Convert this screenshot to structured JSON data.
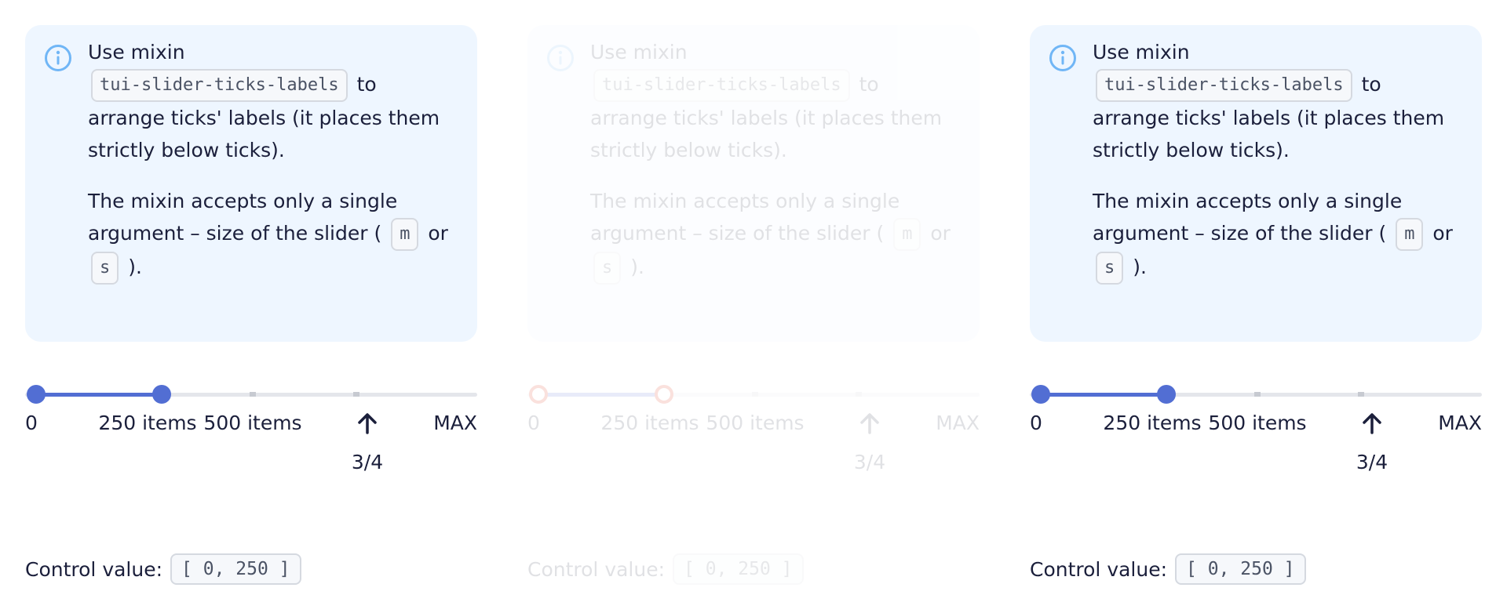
{
  "examples": [
    {
      "variant": "normal",
      "notice": {
        "line_intro": "Use mixin",
        "mixin_name": "tui-slider-ticks-labels",
        "line_rest": "to arrange ticks' labels (it places them strictly below ticks).",
        "para2_start": "The mixin accepts only a single argument – size of the slider (",
        "size_m": "m",
        "or_word": "or",
        "size_s": "s",
        "para2_end": ")."
      },
      "slider": {
        "min": 0,
        "max": 1000,
        "value": [
          0,
          250
        ]
      },
      "tick_labels": [
        "0",
        "250 items",
        "500 items",
        "MAX"
      ],
      "arrow_label": "3/4",
      "control": {
        "label": "Control value:",
        "value": "[ 0, 250 ]"
      }
    },
    {
      "variant": "faded",
      "notice": {
        "line_intro": "Use mixin",
        "mixin_name": "tui-slider-ticks-labels",
        "line_rest": "to arrange ticks' labels (it places them strictly below ticks).",
        "para2_start": "The mixin accepts only a single argument – size of the slider (",
        "size_m": "m",
        "or_word": "or",
        "size_s": "s",
        "para2_end": ")."
      },
      "slider": {
        "min": 0,
        "max": 1000,
        "value": [
          0,
          250
        ]
      },
      "tick_labels": [
        "0",
        "250 items",
        "500 items",
        "MAX"
      ],
      "arrow_label": "3/4",
      "control": {
        "label": "Control value:",
        "value": "[ 0, 250 ]"
      }
    },
    {
      "variant": "normal",
      "notice": {
        "line_intro": "Use mixin",
        "mixin_name": "tui-slider-ticks-labels",
        "line_rest": "to arrange ticks' labels (it places them strictly below ticks).",
        "para2_start": "The mixin accepts only a single argument – size of the slider (",
        "size_m": "m",
        "or_word": "or",
        "size_s": "s",
        "para2_end": ")."
      },
      "slider": {
        "min": 0,
        "max": 1000,
        "value": [
          0,
          250
        ]
      },
      "tick_labels": [
        "0",
        "250 items",
        "500 items",
        "MAX"
      ],
      "arrow_label": "3/4",
      "control": {
        "label": "Control value:",
        "value": "[ 0, 250 ]"
      }
    }
  ],
  "colors": {
    "accent": "#526ed3",
    "notice_bg": "#eef6ff",
    "info_icon": "#70b6f6",
    "text": "#1b1f3b",
    "faded_thumb_border": "#dd2200"
  },
  "icons": {
    "notice": "info-circle-icon",
    "arrow": "arrow-up-icon"
  }
}
